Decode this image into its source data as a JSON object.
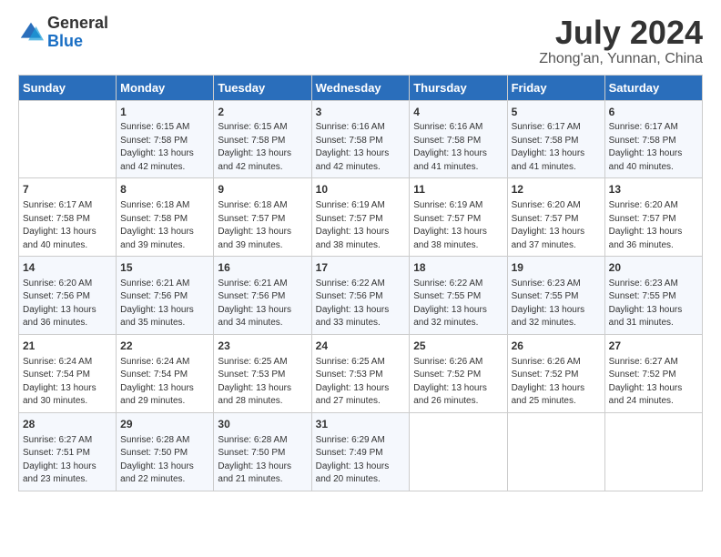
{
  "header": {
    "logo_general": "General",
    "logo_blue": "Blue",
    "month_year": "July 2024",
    "location": "Zhong'an, Yunnan, China"
  },
  "days_of_week": [
    "Sunday",
    "Monday",
    "Tuesday",
    "Wednesday",
    "Thursday",
    "Friday",
    "Saturday"
  ],
  "weeks": [
    [
      {
        "day": "",
        "sunrise": "",
        "sunset": "",
        "daylight": ""
      },
      {
        "day": "1",
        "sunrise": "Sunrise: 6:15 AM",
        "sunset": "Sunset: 7:58 PM",
        "daylight": "Daylight: 13 hours and 42 minutes."
      },
      {
        "day": "2",
        "sunrise": "Sunrise: 6:15 AM",
        "sunset": "Sunset: 7:58 PM",
        "daylight": "Daylight: 13 hours and 42 minutes."
      },
      {
        "day": "3",
        "sunrise": "Sunrise: 6:16 AM",
        "sunset": "Sunset: 7:58 PM",
        "daylight": "Daylight: 13 hours and 42 minutes."
      },
      {
        "day": "4",
        "sunrise": "Sunrise: 6:16 AM",
        "sunset": "Sunset: 7:58 PM",
        "daylight": "Daylight: 13 hours and 41 minutes."
      },
      {
        "day": "5",
        "sunrise": "Sunrise: 6:17 AM",
        "sunset": "Sunset: 7:58 PM",
        "daylight": "Daylight: 13 hours and 41 minutes."
      },
      {
        "day": "6",
        "sunrise": "Sunrise: 6:17 AM",
        "sunset": "Sunset: 7:58 PM",
        "daylight": "Daylight: 13 hours and 40 minutes."
      }
    ],
    [
      {
        "day": "7",
        "sunrise": "Sunrise: 6:17 AM",
        "sunset": "Sunset: 7:58 PM",
        "daylight": "Daylight: 13 hours and 40 minutes."
      },
      {
        "day": "8",
        "sunrise": "Sunrise: 6:18 AM",
        "sunset": "Sunset: 7:58 PM",
        "daylight": "Daylight: 13 hours and 39 minutes."
      },
      {
        "day": "9",
        "sunrise": "Sunrise: 6:18 AM",
        "sunset": "Sunset: 7:57 PM",
        "daylight": "Daylight: 13 hours and 39 minutes."
      },
      {
        "day": "10",
        "sunrise": "Sunrise: 6:19 AM",
        "sunset": "Sunset: 7:57 PM",
        "daylight": "Daylight: 13 hours and 38 minutes."
      },
      {
        "day": "11",
        "sunrise": "Sunrise: 6:19 AM",
        "sunset": "Sunset: 7:57 PM",
        "daylight": "Daylight: 13 hours and 38 minutes."
      },
      {
        "day": "12",
        "sunrise": "Sunrise: 6:20 AM",
        "sunset": "Sunset: 7:57 PM",
        "daylight": "Daylight: 13 hours and 37 minutes."
      },
      {
        "day": "13",
        "sunrise": "Sunrise: 6:20 AM",
        "sunset": "Sunset: 7:57 PM",
        "daylight": "Daylight: 13 hours and 36 minutes."
      }
    ],
    [
      {
        "day": "14",
        "sunrise": "Sunrise: 6:20 AM",
        "sunset": "Sunset: 7:56 PM",
        "daylight": "Daylight: 13 hours and 36 minutes."
      },
      {
        "day": "15",
        "sunrise": "Sunrise: 6:21 AM",
        "sunset": "Sunset: 7:56 PM",
        "daylight": "Daylight: 13 hours and 35 minutes."
      },
      {
        "day": "16",
        "sunrise": "Sunrise: 6:21 AM",
        "sunset": "Sunset: 7:56 PM",
        "daylight": "Daylight: 13 hours and 34 minutes."
      },
      {
        "day": "17",
        "sunrise": "Sunrise: 6:22 AM",
        "sunset": "Sunset: 7:56 PM",
        "daylight": "Daylight: 13 hours and 33 minutes."
      },
      {
        "day": "18",
        "sunrise": "Sunrise: 6:22 AM",
        "sunset": "Sunset: 7:55 PM",
        "daylight": "Daylight: 13 hours and 32 minutes."
      },
      {
        "day": "19",
        "sunrise": "Sunrise: 6:23 AM",
        "sunset": "Sunset: 7:55 PM",
        "daylight": "Daylight: 13 hours and 32 minutes."
      },
      {
        "day": "20",
        "sunrise": "Sunrise: 6:23 AM",
        "sunset": "Sunset: 7:55 PM",
        "daylight": "Daylight: 13 hours and 31 minutes."
      }
    ],
    [
      {
        "day": "21",
        "sunrise": "Sunrise: 6:24 AM",
        "sunset": "Sunset: 7:54 PM",
        "daylight": "Daylight: 13 hours and 30 minutes."
      },
      {
        "day": "22",
        "sunrise": "Sunrise: 6:24 AM",
        "sunset": "Sunset: 7:54 PM",
        "daylight": "Daylight: 13 hours and 29 minutes."
      },
      {
        "day": "23",
        "sunrise": "Sunrise: 6:25 AM",
        "sunset": "Sunset: 7:53 PM",
        "daylight": "Daylight: 13 hours and 28 minutes."
      },
      {
        "day": "24",
        "sunrise": "Sunrise: 6:25 AM",
        "sunset": "Sunset: 7:53 PM",
        "daylight": "Daylight: 13 hours and 27 minutes."
      },
      {
        "day": "25",
        "sunrise": "Sunrise: 6:26 AM",
        "sunset": "Sunset: 7:52 PM",
        "daylight": "Daylight: 13 hours and 26 minutes."
      },
      {
        "day": "26",
        "sunrise": "Sunrise: 6:26 AM",
        "sunset": "Sunset: 7:52 PM",
        "daylight": "Daylight: 13 hours and 25 minutes."
      },
      {
        "day": "27",
        "sunrise": "Sunrise: 6:27 AM",
        "sunset": "Sunset: 7:52 PM",
        "daylight": "Daylight: 13 hours and 24 minutes."
      }
    ],
    [
      {
        "day": "28",
        "sunrise": "Sunrise: 6:27 AM",
        "sunset": "Sunset: 7:51 PM",
        "daylight": "Daylight: 13 hours and 23 minutes."
      },
      {
        "day": "29",
        "sunrise": "Sunrise: 6:28 AM",
        "sunset": "Sunset: 7:50 PM",
        "daylight": "Daylight: 13 hours and 22 minutes."
      },
      {
        "day": "30",
        "sunrise": "Sunrise: 6:28 AM",
        "sunset": "Sunset: 7:50 PM",
        "daylight": "Daylight: 13 hours and 21 minutes."
      },
      {
        "day": "31",
        "sunrise": "Sunrise: 6:29 AM",
        "sunset": "Sunset: 7:49 PM",
        "daylight": "Daylight: 13 hours and 20 minutes."
      },
      {
        "day": "",
        "sunrise": "",
        "sunset": "",
        "daylight": ""
      },
      {
        "day": "",
        "sunrise": "",
        "sunset": "",
        "daylight": ""
      },
      {
        "day": "",
        "sunrise": "",
        "sunset": "",
        "daylight": ""
      }
    ]
  ]
}
